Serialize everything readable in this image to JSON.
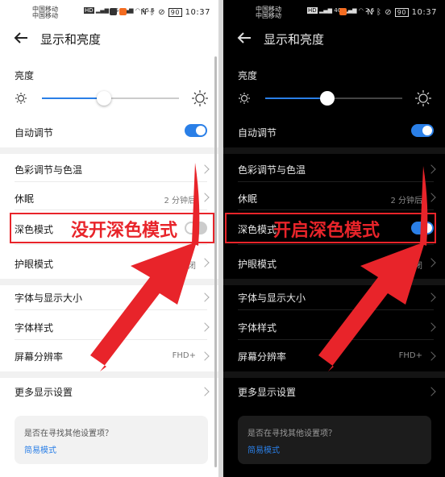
{
  "left_screen": {
    "status": {
      "carrier_line1": "中国移动",
      "carrier_line2": "中国移动",
      "network_badge": "HD",
      "signal_labels": [
        "4G",
        "4G"
      ],
      "speed": "15.6",
      "speed_unit": "K/s",
      "battery": "90",
      "time": "10:37"
    },
    "title": "显示和亮度",
    "brightness_label": "亮度",
    "brightness_level_percent": 45,
    "auto_adjust_label": "自动调节",
    "auto_adjust_on": true,
    "color_temp_label": "色彩调节与色温",
    "sleep_label": "休眠",
    "sleep_value": "2 分钟后",
    "dark_mode_label": "深色模式",
    "dark_mode_on": false,
    "eye_care_label": "护眼模式",
    "eye_care_value": "关闭",
    "font_size_label": "字体与显示大小",
    "font_style_label": "字体样式",
    "resolution_label": "屏幕分辨率",
    "resolution_value": "FHD+",
    "more_label": "更多显示设置",
    "card_question": "是否在寻找其他设置项？",
    "card_link": "简易模式",
    "annotation": "没开深色模式"
  },
  "right_screen": {
    "status": {
      "carrier_line1": "中国移动",
      "carrier_line2": "中国移动",
      "network_badge": "HD",
      "signal_labels": [
        "4G",
        "4G"
      ],
      "speed": "2.6",
      "speed_unit": "K/s",
      "battery": "90",
      "time": "10:37"
    },
    "title": "显示和亮度",
    "brightness_label": "亮度",
    "brightness_level_percent": 45,
    "auto_adjust_label": "自动调节",
    "auto_adjust_on": true,
    "color_temp_label": "色彩调节与色温",
    "sleep_label": "休眠",
    "sleep_value": "2 分钟后",
    "dark_mode_label": "深色模式",
    "dark_mode_on": true,
    "eye_care_label": "护眼模式",
    "eye_care_value": "关闭",
    "font_size_label": "字体与显示大小",
    "font_style_label": "字体样式",
    "resolution_label": "屏幕分辨率",
    "resolution_value": "FHD+",
    "more_label": "更多显示设置",
    "card_question": "是否在寻找其他设置项？",
    "card_link": "简易模式",
    "annotation": "开启深色模式"
  },
  "colors": {
    "accent": "#2a7fe7",
    "annotation_red": "#e8242a",
    "app_badge_orange": "#f36c21"
  },
  "icons": [
    "back-arrow-icon",
    "sun-dim-icon",
    "sun-bright-icon",
    "chevron-right-icon",
    "nfc-icon",
    "bluetooth-icon",
    "mute-icon",
    "battery-icon",
    "wifi-icon",
    "signal-icon"
  ]
}
